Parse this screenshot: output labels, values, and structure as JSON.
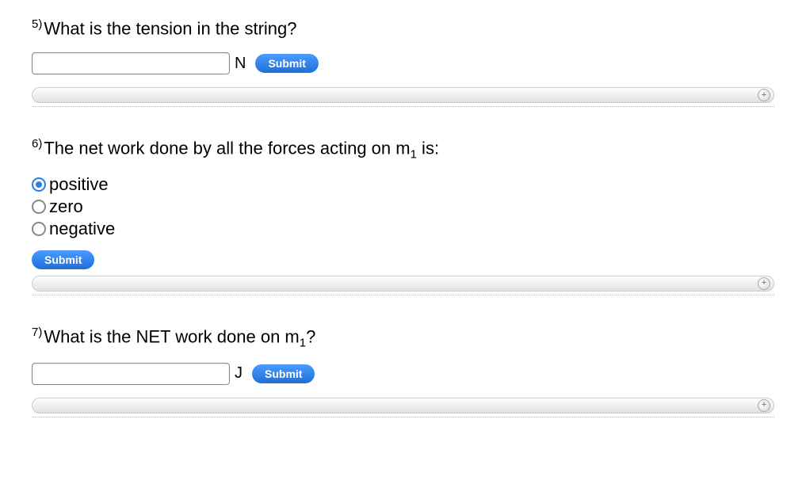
{
  "q5": {
    "number": "5)",
    "text": "What is the tension in the string?",
    "unit": "N",
    "value": "",
    "submit": "Submit"
  },
  "q6": {
    "number": "6)",
    "text_before": "The net work done by all the forces acting on m",
    "text_sub": "1",
    "text_after": " is:",
    "options": {
      "o1": "positive",
      "o2": "zero",
      "o3": "negative"
    },
    "selected": "positive",
    "submit": "Submit"
  },
  "q7": {
    "number": "7)",
    "text_before": "What is the NET work done on m",
    "text_sub": "1",
    "text_after": "?",
    "unit": "J",
    "value": "",
    "submit": "Submit"
  },
  "expander": {
    "plus": "+"
  }
}
